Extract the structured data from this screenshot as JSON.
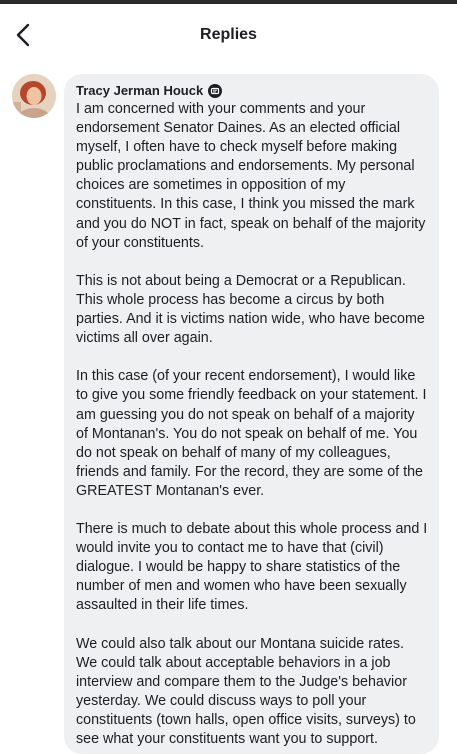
{
  "header": {
    "title": "Replies",
    "back_icon": "chevron-left-icon"
  },
  "comment": {
    "author": "Tracy Jerman Houck",
    "author_badge_icon": "profile-badge-icon",
    "paragraphs": [
      "I am concerned with your comments and your endorsement Senator Daines. As an elected official myself, I often have to check myself before making public proclamations and endorsements. My personal choices are sometimes in opposition of my constituents.  In this case, I think you missed the mark and you do NOT in fact, speak on behalf of the majority of your constituents.",
      "This is not about being a Democrat or a Republican. This whole process has become a circus by both parties. And it is victims nation wide, who have become victims all over again.",
      "In this case (of your recent endorsement), I would like to give you some friendly feedback on your statement. I am guessing you do not speak on behalf of a majority of Montanan's. You do not speak on behalf of me. You do not speak on behalf of many of my colleagues, friends and family. For the record, they are some of the GREATEST Montanan's ever.",
      "There is much to debate about this whole process and I would invite you to contact me to have that (civil) dialogue. I would be happy to share statistics of the number of men and women who have been sexually assaulted in their life times.",
      "We could also talk about our Montana suicide rates. We could talk about acceptable behaviors in a job interview and compare them to the Judge's behavior yesterday. We could discuss ways to poll your constituents (town halls, open office visits, surveys) to see what your constituents want you to support."
    ]
  },
  "colors": {
    "bubble": "#eff0f2",
    "text": "#1c1e21",
    "background": "#ffffff"
  }
}
